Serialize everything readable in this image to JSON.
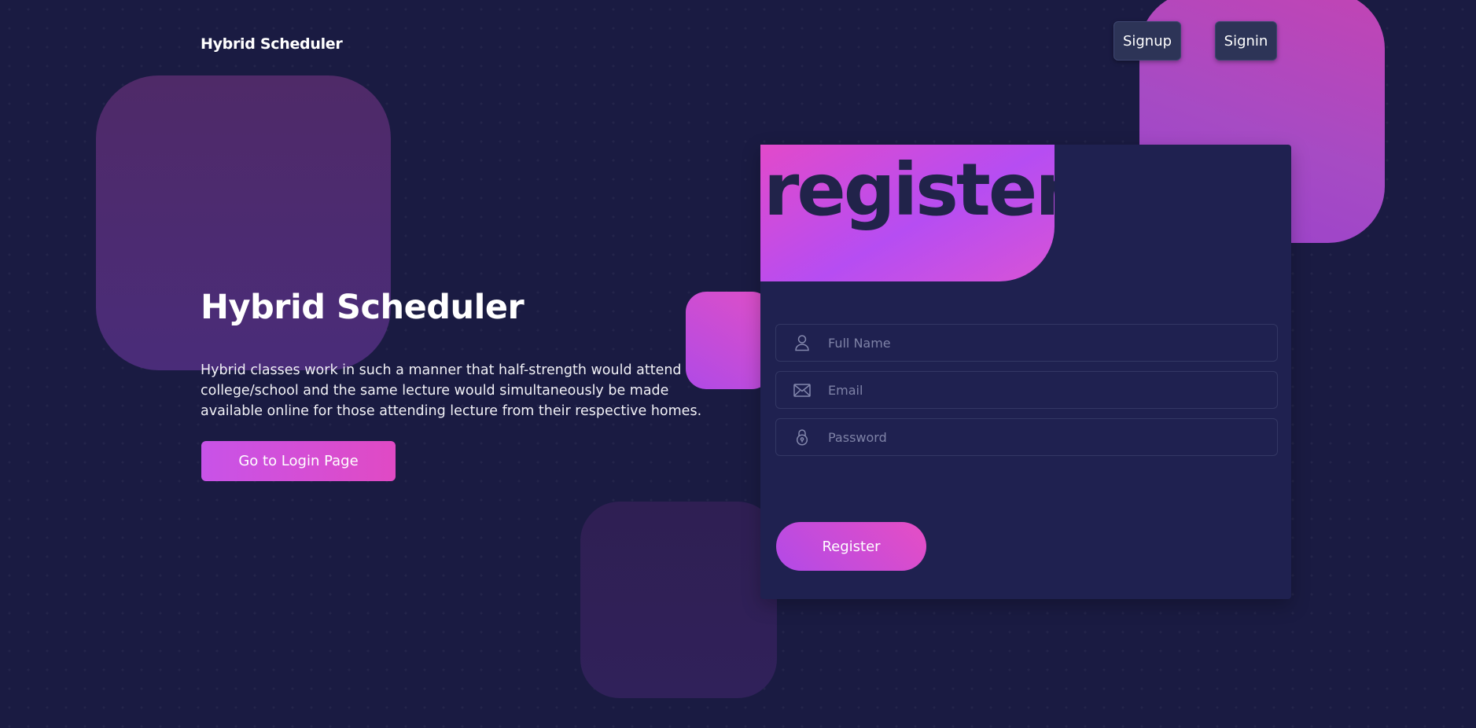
{
  "header": {
    "brand": "Hybrid Scheduler",
    "nav": {
      "signup_label": "Signup",
      "signin_label": "Signin"
    }
  },
  "hero": {
    "title": "Hybrid Scheduler",
    "description": "Hybrid classes work in such a manner that half-strength would attend college/school and the same lecture would simultaneously be made available online for those attending lecture from their respective homes.",
    "cta_label": "Go to Login Page"
  },
  "register_card": {
    "title": "register",
    "fields": {
      "name": {
        "placeholder": "Full Name",
        "value": "",
        "icon": "user-icon"
      },
      "email": {
        "placeholder": "Email",
        "value": "",
        "icon": "mail-icon"
      },
      "password": {
        "placeholder": "Password",
        "value": "",
        "icon": "lock-icon"
      }
    },
    "submit_label": "Register"
  },
  "colors": {
    "background": "#1a1b42",
    "card": "#1f2150",
    "accent_pink": "#e04ac4",
    "accent_purple": "#b24ae7",
    "nav_button": "#2d3457"
  }
}
